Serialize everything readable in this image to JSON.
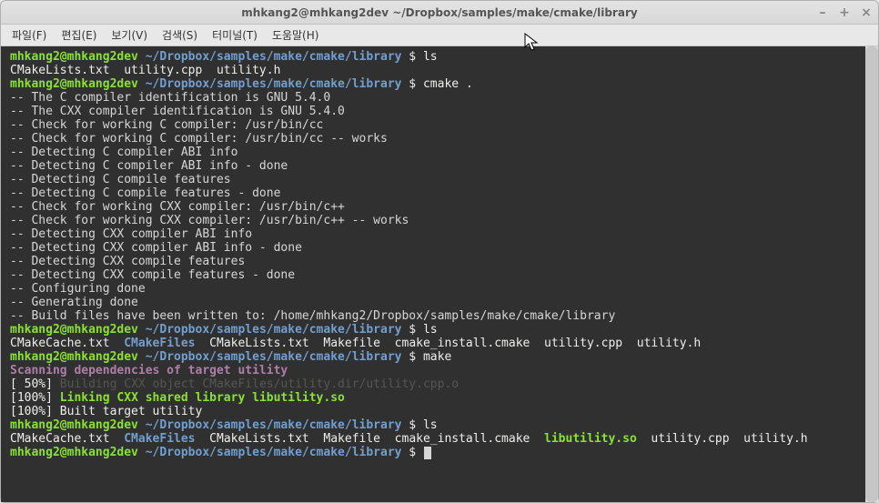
{
  "window": {
    "title": "mhkang2@mhkang2dev ~/Dropbox/samples/make/cmake/library"
  },
  "menu": {
    "file": "파일(F)",
    "edit": "편집(E)",
    "view": "보기(V)",
    "search": "검색(S)",
    "terminal": "터미널(T)",
    "help": "도움말(H)"
  },
  "prompt": {
    "user": "mhkang2@mhkang2dev",
    "path": "~/Dropbox/samples/make/cmake/library",
    "sep": " $ "
  },
  "cmds": {
    "ls1": "ls",
    "cmake": "cmake .",
    "ls2": "ls",
    "make": "make",
    "ls3": "ls"
  },
  "ls1": {
    "list": "CMakeLists.txt  utility.cpp  utility.h"
  },
  "cmake_out": {
    "l01": "-- The C compiler identification is GNU 5.4.0",
    "l02": "-- The CXX compiler identification is GNU 5.4.0",
    "l03": "-- Check for working C compiler: /usr/bin/cc",
    "l04": "-- Check for working C compiler: /usr/bin/cc -- works",
    "l05": "-- Detecting C compiler ABI info",
    "l06": "-- Detecting C compiler ABI info - done",
    "l07": "-- Detecting C compile features",
    "l08": "-- Detecting C compile features - done",
    "l09": "-- Check for working CXX compiler: /usr/bin/c++",
    "l10": "-- Check for working CXX compiler: /usr/bin/c++ -- works",
    "l11": "-- Detecting CXX compiler ABI info",
    "l12": "-- Detecting CXX compiler ABI info - done",
    "l13": "-- Detecting CXX compile features",
    "l14": "-- Detecting CXX compile features - done",
    "l15": "-- Configuring done",
    "l16": "-- Generating done",
    "l17": "-- Build files have been written to: /home/mhkang2/Dropbox/samples/make/cmake/library"
  },
  "ls2": {
    "pre": "CMakeCache.txt  ",
    "dir": "CMakeFiles",
    "post": "  CMakeLists.txt  Makefile  cmake_install.cmake  utility.cpp  utility.h"
  },
  "make_out": {
    "scan": "Scanning dependencies of target utility",
    "p50_pfx": "[ 50%] ",
    "p50_body": "Building CXX object CMakeFiles/utility.dir/utility.cpp.o",
    "p100a_pfx": "[100%] ",
    "p100a_body": "Linking CXX shared library libutility.so",
    "p100b": "[100%] Built target utility"
  },
  "ls3": {
    "pre": "CMakeCache.txt  ",
    "dir": "CMakeFiles",
    "mid1": "  CMakeLists.txt  Makefile  cmake_install.cmake  ",
    "lib": "libutility.so",
    "post": "  utility.cpp  utility.h"
  }
}
